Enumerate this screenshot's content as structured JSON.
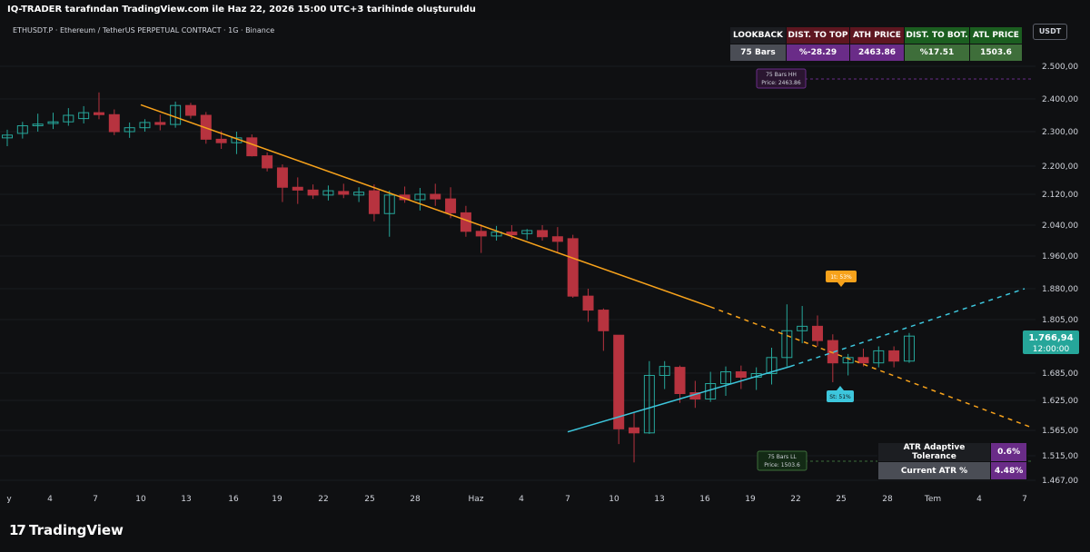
{
  "header": {
    "banner": "IQ-TRADER tarafından TradingView.com ile Haz 22, 2026 15:00 UTC+3 tarihinde oluşturuldu",
    "symbol_line": "ETHUSDT.P · Ethereum / TetherUS PERPETUAL CONTRACT · 1G · Binance",
    "currency": "USDT"
  },
  "footer": {
    "logo_text": "TradingView",
    "logo_icon": "tradingview-logo-icon"
  },
  "colors": {
    "up": "#26a69a",
    "down": "#b7333f",
    "wick": "#d1d4dc",
    "resistance": "#f7a21b",
    "support": "#3dc6dc",
    "header_green": "#1b5e20",
    "header_red": "#5e1620",
    "cell_purple": "#6a2c88",
    "cell_green": "#3e6e3a",
    "cell_gray": "#4a4d55"
  },
  "stats_table": {
    "headers": [
      "LOOKBACK",
      "DIST. TO TOP",
      "ATH PRICE",
      "DIST. TO BOT.",
      "ATL PRICE"
    ],
    "values": [
      "75 Bars",
      "%-28.29",
      "2463.86",
      "%17.51",
      "1503.6"
    ]
  },
  "atr_table": {
    "rows": [
      {
        "label": "ATR Adaptive Tolerance",
        "value": "0.6%"
      },
      {
        "label": "Current ATR %",
        "value": "4.48%"
      }
    ]
  },
  "markers": {
    "hh_line1": "75 Bars HH",
    "hh_line2": "Price: 2463.86",
    "ll_line1": "75 Bars LL",
    "ll_line2": "Price: 1503.6",
    "resistance_label": "1t: 53%",
    "support_label": "St: 51%"
  },
  "chart_data": {
    "type": "candlestick",
    "price_ticks": [
      "2.500,00",
      "2.400,00",
      "2.300,00",
      "2.200,00",
      "2.120,00",
      "2.040,00",
      "1.960,00",
      "1.880,00",
      "1.805,00",
      "1.685,00",
      "1.625,00",
      "1.565,00",
      "1.515,00",
      "1.467,00"
    ],
    "price_tick_values": [
      2500,
      2400,
      2300,
      2200,
      2120,
      2040,
      1960,
      1880,
      1805,
      1685,
      1625,
      1565,
      1515,
      1467
    ],
    "time_labels": [
      "y",
      "4",
      "7",
      "10",
      "13",
      "16",
      "19",
      "22",
      "25",
      "28",
      "Haz",
      "4",
      "7",
      "10",
      "13",
      "16",
      "19",
      "22",
      "25",
      "28",
      "Tem",
      "4",
      "7"
    ],
    "current_price": "1.766,94",
    "current_time": "12:00:00",
    "current_price_value": 1766.94,
    "candles": [
      {
        "o": 2282,
        "h": 2306,
        "l": 2258,
        "c": 2290
      },
      {
        "o": 2295,
        "h": 2330,
        "l": 2280,
        "c": 2318
      },
      {
        "o": 2318,
        "h": 2355,
        "l": 2300,
        "c": 2323
      },
      {
        "o": 2325,
        "h": 2358,
        "l": 2308,
        "c": 2330
      },
      {
        "o": 2330,
        "h": 2372,
        "l": 2318,
        "c": 2350
      },
      {
        "o": 2340,
        "h": 2378,
        "l": 2325,
        "c": 2358
      },
      {
        "o": 2358,
        "h": 2420,
        "l": 2338,
        "c": 2352
      },
      {
        "o": 2352,
        "h": 2368,
        "l": 2290,
        "c": 2300
      },
      {
        "o": 2300,
        "h": 2328,
        "l": 2282,
        "c": 2312
      },
      {
        "o": 2312,
        "h": 2338,
        "l": 2300,
        "c": 2328
      },
      {
        "o": 2328,
        "h": 2352,
        "l": 2304,
        "c": 2322
      },
      {
        "o": 2322,
        "h": 2392,
        "l": 2312,
        "c": 2380
      },
      {
        "o": 2380,
        "h": 2388,
        "l": 2340,
        "c": 2350
      },
      {
        "o": 2350,
        "h": 2360,
        "l": 2265,
        "c": 2278
      },
      {
        "o": 2278,
        "h": 2302,
        "l": 2250,
        "c": 2268
      },
      {
        "o": 2268,
        "h": 2300,
        "l": 2235,
        "c": 2282
      },
      {
        "o": 2282,
        "h": 2292,
        "l": 2228,
        "c": 2230
      },
      {
        "o": 2230,
        "h": 2240,
        "l": 2185,
        "c": 2195
      },
      {
        "o": 2195,
        "h": 2205,
        "l": 2100,
        "c": 2140
      },
      {
        "o": 2140,
        "h": 2168,
        "l": 2095,
        "c": 2132
      },
      {
        "o": 2132,
        "h": 2148,
        "l": 2108,
        "c": 2118
      },
      {
        "o": 2118,
        "h": 2145,
        "l": 2104,
        "c": 2130
      },
      {
        "o": 2128,
        "h": 2150,
        "l": 2110,
        "c": 2120
      },
      {
        "o": 2118,
        "h": 2140,
        "l": 2100,
        "c": 2126
      },
      {
        "o": 2130,
        "h": 2148,
        "l": 2050,
        "c": 2070
      },
      {
        "o": 2070,
        "h": 2130,
        "l": 2010,
        "c": 2118
      },
      {
        "o": 2118,
        "h": 2142,
        "l": 2098,
        "c": 2106
      },
      {
        "o": 2106,
        "h": 2138,
        "l": 2078,
        "c": 2120
      },
      {
        "o": 2120,
        "h": 2150,
        "l": 2090,
        "c": 2108
      },
      {
        "o": 2108,
        "h": 2140,
        "l": 2058,
        "c": 2072
      },
      {
        "o": 2072,
        "h": 2090,
        "l": 2010,
        "c": 2024
      },
      {
        "o": 2024,
        "h": 2042,
        "l": 1968,
        "c": 2012
      },
      {
        "o": 2012,
        "h": 2038,
        "l": 2000,
        "c": 2022
      },
      {
        "o": 2022,
        "h": 2040,
        "l": 2004,
        "c": 2015
      },
      {
        "o": 2018,
        "h": 2030,
        "l": 2002,
        "c": 2026
      },
      {
        "o": 2026,
        "h": 2040,
        "l": 2000,
        "c": 2010
      },
      {
        "o": 2010,
        "h": 2035,
        "l": 1970,
        "c": 1998
      },
      {
        "o": 2005,
        "h": 2015,
        "l": 1858,
        "c": 1862
      },
      {
        "o": 1862,
        "h": 1880,
        "l": 1800,
        "c": 1828
      },
      {
        "o": 1828,
        "h": 1832,
        "l": 1735,
        "c": 1780
      },
      {
        "o": 1770,
        "h": 1770,
        "l": 1538,
        "c": 1568
      },
      {
        "o": 1570,
        "h": 1600,
        "l": 1502,
        "c": 1560
      },
      {
        "o": 1560,
        "h": 1712,
        "l": 1558,
        "c": 1680
      },
      {
        "o": 1680,
        "h": 1712,
        "l": 1650,
        "c": 1700
      },
      {
        "o": 1698,
        "h": 1702,
        "l": 1620,
        "c": 1640
      },
      {
        "o": 1642,
        "h": 1668,
        "l": 1610,
        "c": 1628
      },
      {
        "o": 1628,
        "h": 1688,
        "l": 1622,
        "c": 1662
      },
      {
        "o": 1662,
        "h": 1700,
        "l": 1635,
        "c": 1688
      },
      {
        "o": 1688,
        "h": 1702,
        "l": 1650,
        "c": 1676
      },
      {
        "o": 1676,
        "h": 1698,
        "l": 1648,
        "c": 1684
      },
      {
        "o": 1684,
        "h": 1742,
        "l": 1660,
        "c": 1720
      },
      {
        "o": 1720,
        "h": 1842,
        "l": 1700,
        "c": 1780
      },
      {
        "o": 1780,
        "h": 1838,
        "l": 1752,
        "c": 1790
      },
      {
        "o": 1790,
        "h": 1815,
        "l": 1745,
        "c": 1758
      },
      {
        "o": 1758,
        "h": 1772,
        "l": 1665,
        "c": 1708
      },
      {
        "o": 1708,
        "h": 1728,
        "l": 1680,
        "c": 1720
      },
      {
        "o": 1720,
        "h": 1740,
        "l": 1700,
        "c": 1708
      },
      {
        "o": 1708,
        "h": 1745,
        "l": 1698,
        "c": 1735
      },
      {
        "o": 1735,
        "h": 1745,
        "l": 1698,
        "c": 1712
      },
      {
        "o": 1712,
        "h": 1775,
        "l": 1708,
        "c": 1768
      }
    ]
  }
}
